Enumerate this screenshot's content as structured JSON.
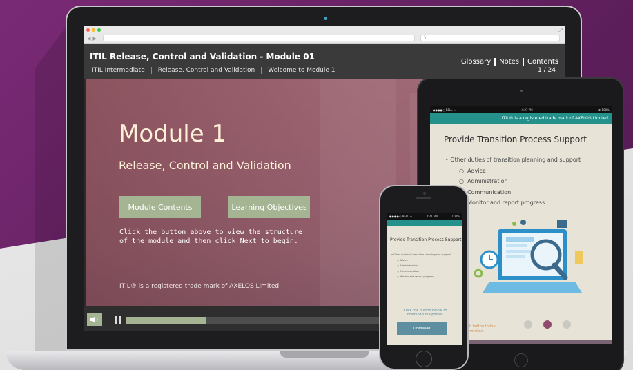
{
  "course": {
    "title": "ITIL Release, Control and Validation - Module 01",
    "breadcrumb": [
      "ITIL Intermediate",
      "Release, Control and Validation",
      "Welcome to Module 1"
    ],
    "links": {
      "glossary": "Glossary",
      "notes": "Notes",
      "contents": "Contents"
    },
    "page_count": "1 / 24"
  },
  "hero": {
    "title": "Module 1",
    "subtitle": "Release, Control and Validation",
    "buttons": {
      "contents": "Module Contents",
      "objectives": "Learning Objectives"
    },
    "instructions": "Click the button above to view the structure of the module and then click Next to begin.",
    "trademark": "ITIL® is a registered trade mark of AXELOS Limited"
  },
  "player": {
    "progress_fraction": 0.29
  },
  "tablet": {
    "status": {
      "carrier": "●●●●○ BELL ≈",
      "time": "4:21 PM",
      "battery": "✱ 100%"
    },
    "banner": "ITIL® is a registered trade mark of AXELOS Limited",
    "title": "Provide Transition Process Support",
    "list": {
      "main": "Other duties of transition planning and support",
      "items": [
        "Advice",
        "Administration",
        "Communication",
        "Monitor and report progress"
      ]
    },
    "hint": "each button to the information.",
    "dots": 3,
    "active_dot": 1
  },
  "phone": {
    "status": {
      "carrier": "●●●●○ BELL ≈",
      "time": "4:21 PM",
      "battery": "100%"
    },
    "title": "Provide Transition Process Support",
    "list": {
      "main": "Other duties of transition planning and support",
      "items": [
        "Advice",
        "Administration",
        "Communication",
        "Monitor and report progress"
      ]
    },
    "instructions": "Click the button below to download the poster.",
    "button": "Download"
  },
  "colors": {
    "accent_green": "#a5b593",
    "teal": "#24918b",
    "background_purple": "#6b2367"
  },
  "icons": [
    "volume-icon",
    "pause-icon",
    "back-arrow-icon",
    "forward-arrow-icon",
    "search-icon",
    "expand-icon"
  ]
}
